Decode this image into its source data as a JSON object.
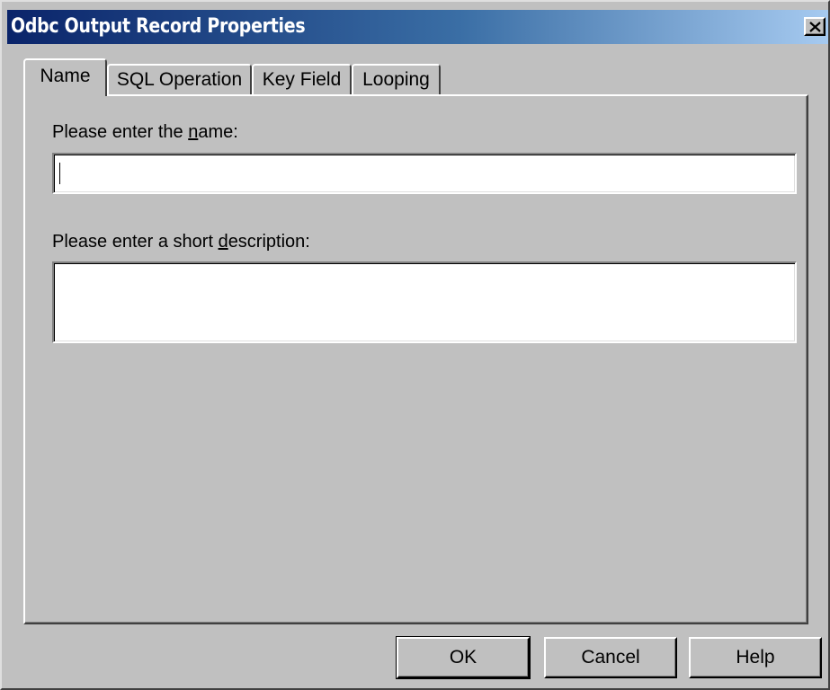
{
  "window": {
    "title": "Odbc Output Record Properties"
  },
  "tabs": [
    {
      "label": "Name",
      "active": true
    },
    {
      "label": "SQL Operation",
      "active": false
    },
    {
      "label": "Key Field",
      "active": false
    },
    {
      "label": "Looping",
      "active": false
    }
  ],
  "name_section": {
    "label_prefix": "Please enter the ",
    "label_accel": "n",
    "label_suffix": "ame:",
    "value": ""
  },
  "description_section": {
    "label_prefix": "Please enter a short ",
    "label_accel": "d",
    "label_suffix": "escription:",
    "value": ""
  },
  "buttons": {
    "ok": "OK",
    "cancel": "Cancel",
    "help": "Help"
  },
  "icons": {
    "close": "close-icon"
  }
}
